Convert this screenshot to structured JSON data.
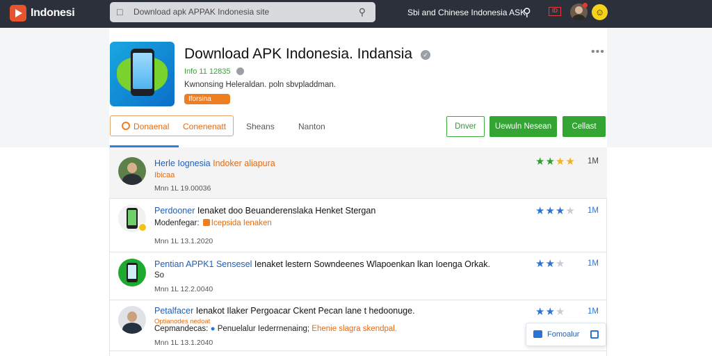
{
  "topbar": {
    "logo_text": "Indonesi",
    "search_placeholder": "Download apk APPAK Indonesia site",
    "links": "Sbi and Chinese Indonesia ASK",
    "flag_text": "ID"
  },
  "app": {
    "title": "Download APK Indonesia. Indansia",
    "developer": "Info 11 12835",
    "description": "Kwnonsing Heleraldan. poln sbvpladdman.",
    "badge": "Iforsina"
  },
  "tabs": [
    {
      "label": "Donaenal"
    },
    {
      "label": "Conenenatt"
    },
    {
      "label": "Sheans"
    },
    {
      "label": "Nanton"
    }
  ],
  "actions": {
    "outline": "Dnver",
    "download": "Uewuln Nesean",
    "collect": "Cellast"
  },
  "rows": [
    {
      "title_blue": "Herle Iognesia",
      "title_orange": "Indoker aliapura",
      "sub": "Ibicaa",
      "meta": "Mnn 1L  19.00036",
      "count": "1M"
    },
    {
      "title_blue": "Perdooner",
      "title_rest": "Ienaket doo Beuanderenslaka Henket Stergan",
      "sub_dark": "Modenfegar:",
      "sub_orange": "Icepsida Ienaken",
      "meta": "Mnn 1L  13.1.2020",
      "count": "1M"
    },
    {
      "title_blue": "Pentian APPK1 Sensesel",
      "title_rest": "Ienaket lestern Sowndeenes Wlapoenkan lkan Ioenga Orkak.",
      "sub_dark": "So",
      "meta": "Mnn 1L  12.2.0040",
      "count": "1M"
    },
    {
      "title_blue": "Petalfacer",
      "title_rest": "Ienakot Ilaker Pergoacar Ckent Pecan lane t hedoonuge.",
      "sub": "Optianodes nedoat",
      "sub_dark": "Cepmandecas:",
      "sub_dark2": "Penuelalur Iederrnenaing;",
      "sub_orange": "Ehenie slagra skendpal.",
      "meta": "Mnn 1L  13.1.2040",
      "count": "1M"
    }
  ],
  "float_button": {
    "label": "Fomoalur"
  },
  "colors": {
    "topbar": "#2b303b",
    "accent_orange": "#ef7d22",
    "accent_green": "#32a532",
    "link_blue": "#1f5fb8"
  },
  "icons": [
    "play-logo-icon",
    "search-icon",
    "flag-icon",
    "avatar",
    "emoji-icon",
    "verified-icon",
    "more-icon",
    "star-icon",
    "share-icon"
  ]
}
